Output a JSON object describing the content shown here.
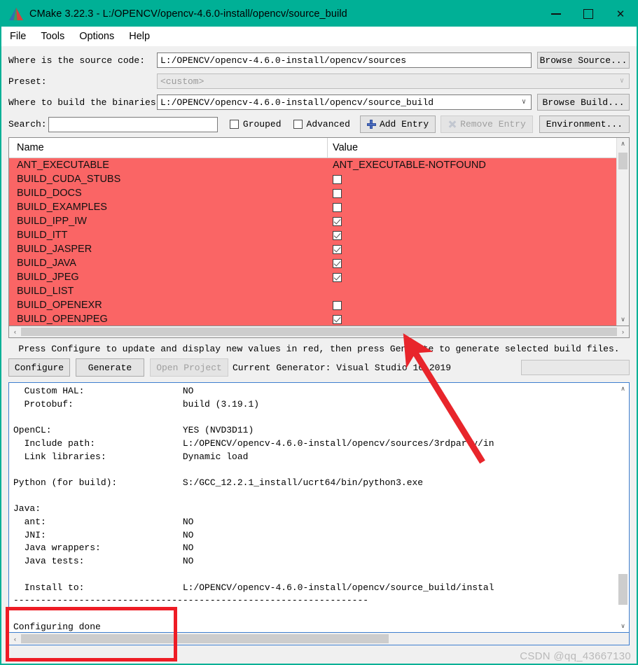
{
  "window": {
    "title": "CMake 3.22.3 - L:/OPENCV/opencv-4.6.0-install/opencv/source_build",
    "app_icon": "cmake-logo-icon",
    "minimize_label": "–",
    "maximize_label": "□",
    "close_label": "✕",
    "titlebar_color": "#00b096"
  },
  "menubar": {
    "items": [
      {
        "label": "File"
      },
      {
        "label": "Tools"
      },
      {
        "label": "Options"
      },
      {
        "label": "Help"
      }
    ]
  },
  "form": {
    "source_label": "Where is the source code:",
    "source_value": "L:/OPENCV/opencv-4.6.0-install/opencv/sources",
    "browse_source_label": "Browse Source...",
    "preset_label": "Preset:",
    "preset_value": "<custom>",
    "binaries_label": "Where to build the binaries:",
    "binaries_value": "L:/OPENCV/opencv-4.6.0-install/opencv/source_build",
    "browse_build_label": "Browse Build...",
    "dropdown_arrow": "∨"
  },
  "search": {
    "label": "Search:",
    "value": "",
    "placeholder": "",
    "grouped_label": "Grouped",
    "grouped_checked": false,
    "advanced_label": "Advanced",
    "advanced_checked": false,
    "add_entry_label": "Add Entry",
    "add_entry_icon": "plus-icon",
    "remove_entry_label": "Remove Entry",
    "remove_entry_icon": "cross-icon",
    "remove_entry_disabled": true,
    "environment_label": "Environment..."
  },
  "cache": {
    "highlight_color": "#fa6565",
    "columns": [
      "Name",
      "Value"
    ],
    "rows": [
      {
        "name": "ANT_EXECUTABLE",
        "type": "text",
        "value": "ANT_EXECUTABLE-NOTFOUND"
      },
      {
        "name": "BUILD_CUDA_STUBS",
        "type": "checkbox",
        "checked": false
      },
      {
        "name": "BUILD_DOCS",
        "type": "checkbox",
        "checked": false
      },
      {
        "name": "BUILD_EXAMPLES",
        "type": "checkbox",
        "checked": false
      },
      {
        "name": "BUILD_IPP_IW",
        "type": "checkbox",
        "checked": true
      },
      {
        "name": "BUILD_ITT",
        "type": "checkbox",
        "checked": true
      },
      {
        "name": "BUILD_JASPER",
        "type": "checkbox",
        "checked": true
      },
      {
        "name": "BUILD_JAVA",
        "type": "checkbox",
        "checked": true
      },
      {
        "name": "BUILD_JPEG",
        "type": "checkbox",
        "checked": true
      },
      {
        "name": "BUILD_LIST",
        "type": "text",
        "value": ""
      },
      {
        "name": "BUILD_OPENEXR",
        "type": "checkbox",
        "checked": false
      },
      {
        "name": "BUILD_OPENJPEG",
        "type": "checkbox",
        "checked": true
      }
    ],
    "scroll_up_icon": "∧",
    "scroll_down_icon": "∨",
    "scroll_left_icon": "‹",
    "scroll_right_icon": "›"
  },
  "status": {
    "hint": "Press Configure to update and display new values in red, then press Generate to generate selected build files.",
    "configure_label": "Configure",
    "generate_label": "Generate",
    "open_project_label": "Open Project",
    "open_project_disabled": true,
    "generator_text": "Current Generator: Visual Studio 16 2019"
  },
  "log": {
    "content": "  Custom HAL:                  NO\n  Protobuf:                    build (3.19.1)\n\nOpenCL:                        YES (NVD3D11)\n  Include path:                L:/OPENCV/opencv-4.6.0-install/opencv/sources/3rdparty/in\n  Link libraries:              Dynamic load\n\nPython (for build):            S:/GCC_12.2.1_install/ucrt64/bin/python3.exe\n\nJava:\n  ant:                         NO\n  JNI:                         NO\n  Java wrappers:               NO\n  Java tests:                  NO\n\n  Install to:                  L:/OPENCV/opencv-4.6.0-install/opencv/source_build/instal\n-----------------------------------------------------------------\n\nConfiguring done",
    "scroll_up_icon": "∧",
    "scroll_down_icon": "∨",
    "scroll_left_icon": "‹"
  },
  "annotations": {
    "arrow_color": "#e8252b",
    "box_color": "#ee1c25",
    "watermark": "CSDN @qq_43667130"
  }
}
